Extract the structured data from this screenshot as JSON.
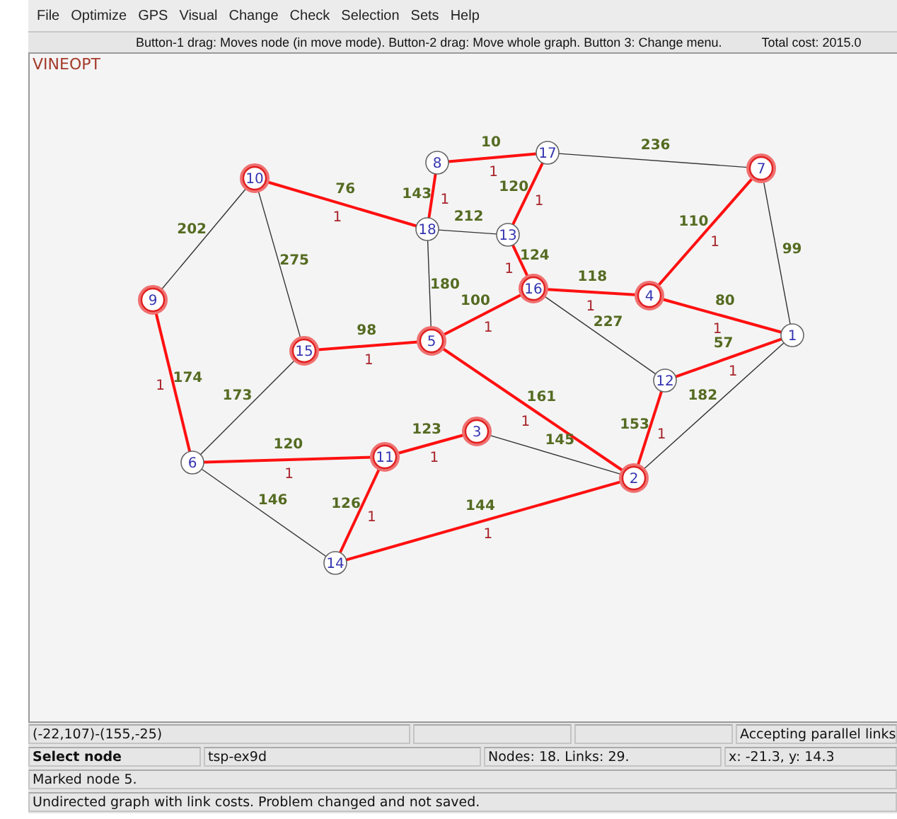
{
  "menu": [
    {
      "label": "File"
    },
    {
      "label": "Optimize"
    },
    {
      "label": "GPS"
    },
    {
      "label": "Visual"
    },
    {
      "label": "Change"
    },
    {
      "label": "Check"
    },
    {
      "label": "Selection"
    },
    {
      "label": "Sets"
    },
    {
      "label": "Help"
    }
  ],
  "info_bar": {
    "hint": "Button-1 drag: Moves node (in move mode). Button-2 drag: Move whole graph. Button 3: Change menu.",
    "total_cost": "Total cost: 2015.0"
  },
  "canvas": {
    "title": "VINEOPT",
    "nodes": [
      {
        "label": "1",
        "highlighted": false
      },
      {
        "label": "2",
        "highlighted": true
      },
      {
        "label": "3",
        "highlighted": true
      },
      {
        "label": "4",
        "highlighted": true
      },
      {
        "label": "5",
        "highlighted": true
      },
      {
        "label": "6",
        "highlighted": false
      },
      {
        "label": "7",
        "highlighted": true
      },
      {
        "label": "8",
        "highlighted": false
      },
      {
        "label": "9",
        "highlighted": true
      },
      {
        "label": "10",
        "highlighted": true
      },
      {
        "label": "11",
        "highlighted": true
      },
      {
        "label": "12",
        "highlighted": false
      },
      {
        "label": "13",
        "highlighted": false
      },
      {
        "label": "14",
        "highlighted": false
      },
      {
        "label": "15",
        "highlighted": true
      },
      {
        "label": "16",
        "highlighted": true
      },
      {
        "label": "17",
        "highlighted": false
      },
      {
        "label": "18",
        "highlighted": false
      }
    ],
    "edges": [
      {
        "cost": "10",
        "in_tour": true,
        "flow": "1"
      },
      {
        "cost": "236",
        "in_tour": false
      },
      {
        "cost": "76",
        "in_tour": true,
        "flow": "1"
      },
      {
        "cost": "143",
        "in_tour": true,
        "flow": "1"
      },
      {
        "cost": "120",
        "in_tour": true,
        "flow": "1"
      },
      {
        "cost": "212",
        "in_tour": false
      },
      {
        "cost": "202",
        "in_tour": false
      },
      {
        "cost": "110",
        "in_tour": true,
        "flow": "1"
      },
      {
        "cost": "275",
        "in_tour": false
      },
      {
        "cost": "124",
        "in_tour": true,
        "flow": "1"
      },
      {
        "cost": "99",
        "in_tour": false
      },
      {
        "cost": "180",
        "in_tour": false
      },
      {
        "cost": "118",
        "in_tour": true,
        "flow": "1"
      },
      {
        "cost": "100",
        "in_tour": true,
        "flow": "1"
      },
      {
        "cost": "80",
        "in_tour": true,
        "flow": "1"
      },
      {
        "cost": "227",
        "in_tour": false
      },
      {
        "cost": "98",
        "in_tour": true,
        "flow": "1"
      },
      {
        "cost": "57",
        "in_tour": true,
        "flow": "1"
      },
      {
        "cost": "174",
        "in_tour": true,
        "flow": "1"
      },
      {
        "cost": "173",
        "in_tour": false
      },
      {
        "cost": "161",
        "in_tour": true,
        "flow": "1"
      },
      {
        "cost": "182",
        "in_tour": false
      },
      {
        "cost": "123",
        "in_tour": true,
        "flow": "1"
      },
      {
        "cost": "145",
        "in_tour": false
      },
      {
        "cost": "153",
        "in_tour": true,
        "flow": "1"
      },
      {
        "cost": "120",
        "in_tour": true,
        "flow": "1"
      },
      {
        "cost": "146",
        "in_tour": false
      },
      {
        "cost": "126",
        "in_tour": true,
        "flow": "1"
      },
      {
        "cost": "144",
        "in_tour": true,
        "flow": "1"
      }
    ]
  },
  "status_bar": {
    "region": "(-22,107)-(155,-25)",
    "mode_note": "Accepting parallel links",
    "tool": "Select node",
    "file": "tsp-ex9d",
    "counts": "Nodes: 18. Links: 29.",
    "cursor": "x: -21.3, y: 14.3",
    "message": "Marked node 5.",
    "problem_state": "Undirected graph with link costs. Problem changed and not saved."
  }
}
